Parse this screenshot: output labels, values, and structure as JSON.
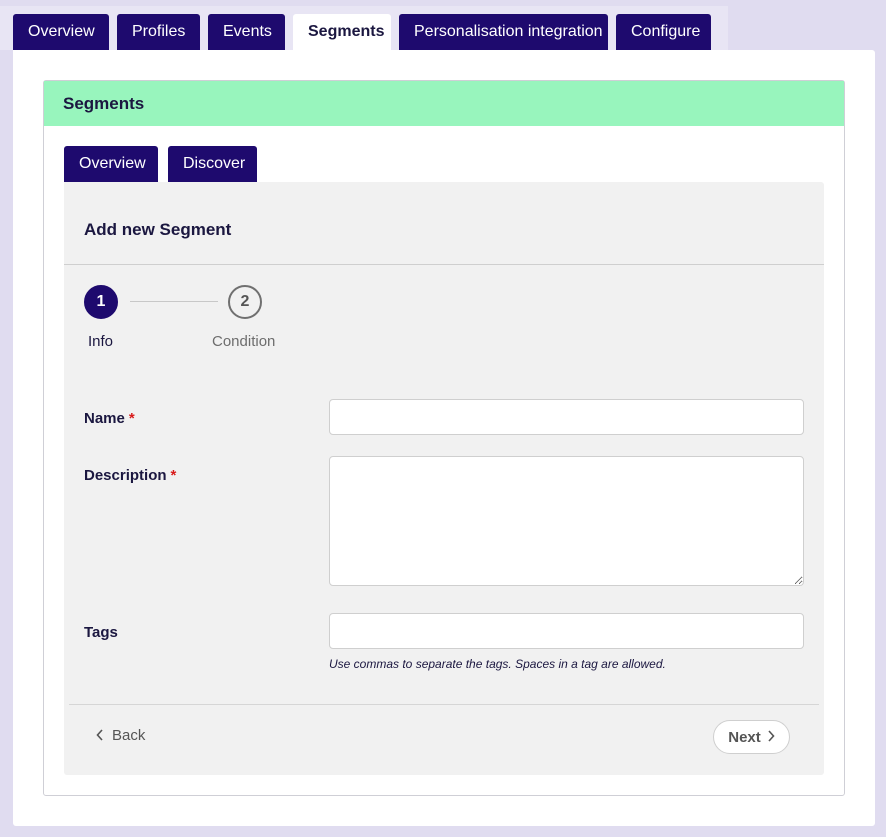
{
  "top_tabs": [
    {
      "label": "Overview"
    },
    {
      "label": "Profiles"
    },
    {
      "label": "Events"
    },
    {
      "label": "Segments"
    },
    {
      "label": "Personalisation integration"
    },
    {
      "label": "Configure"
    }
  ],
  "active_top_tab": "Segments",
  "panel": {
    "title": "Segments",
    "sub_tabs": [
      {
        "label": "Overview"
      },
      {
        "label": "Discover"
      }
    ]
  },
  "form": {
    "title": "Add new Segment",
    "steps": [
      {
        "number": "1",
        "label": "Info"
      },
      {
        "number": "2",
        "label": "Condition"
      }
    ],
    "fields": {
      "name": {
        "label": "Name",
        "required_marker": "*",
        "value": ""
      },
      "description": {
        "label": "Description",
        "required_marker": "*",
        "value": ""
      },
      "tags": {
        "label": "Tags",
        "value": "",
        "help": "Use commas to separate the tags. Spaces in a tag are allowed."
      }
    },
    "back_label": "Back",
    "next_label": "Next"
  },
  "icons": {
    "back": "chevron-left-icon",
    "next": "chevron-right-icon"
  },
  "colors": {
    "primary": "#1e0a6e",
    "header_green": "#98f5bd",
    "required": "#d81a1a"
  }
}
